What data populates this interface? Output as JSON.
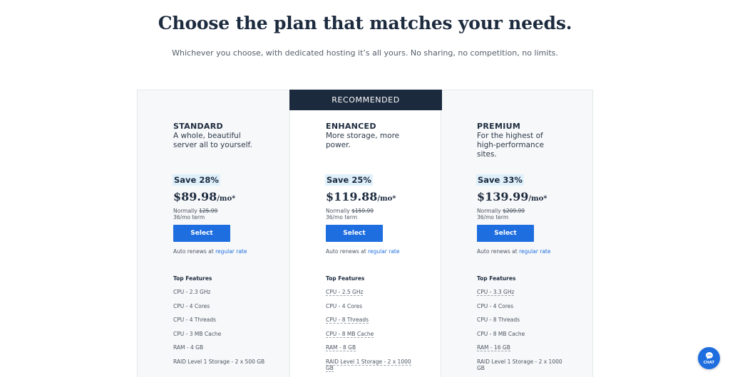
{
  "header": {
    "title": "Choose the plan that matches your needs.",
    "subtitle": "Whichever you choose, with dedicated hosting it’s all yours. No sharing, no competition, no limits."
  },
  "recommended_label": "RECOMMENDED",
  "colors": {
    "accent": "#1e6ee0",
    "dark": "#1c2a3d",
    "save_bg": "#dff0fb"
  },
  "plans": [
    {
      "name": "STANDARD",
      "description": "A whole, beautiful server all to yourself.",
      "save": "Save 28%",
      "price": "$89.98",
      "per": "/mo*",
      "normally_label": "Normally",
      "normally_price": "125.99",
      "term": "36/mo term",
      "select_label": "Select",
      "renews_text": "Auto renews at",
      "renews_link": "regular rate",
      "features_title": "Top Features",
      "features": [
        "CPU - 2.3 GHz",
        "CPU - 4 Cores",
        "CPU - 4 Threads",
        "CPU - 3 MB Cache",
        "RAM - 4 GB",
        "RAID Level 1 Storage - 2 x 500 GB"
      ]
    },
    {
      "name": "ENHANCED",
      "description": "More storage, more power.",
      "save": "Save 25%",
      "price": "$119.88",
      "per": "/mo*",
      "normally_label": "Normally",
      "normally_price": "$159.99",
      "term": "36/mo term",
      "select_label": "Select",
      "renews_text": "Auto renews at",
      "renews_link": "regular rate",
      "features_title": "Top Features",
      "features": [
        "CPU - 2.5 GHz",
        "CPU - 4 Cores",
        "CPU - 8 Threads",
        "CPU - 8 MB Cache",
        "RAM - 8 GB",
        "RAID Level 1 Storage - 2 x 1000 GB"
      ]
    },
    {
      "name": "PREMIUM",
      "description": "For the highest of high-performance sites.",
      "save": "Save 33%",
      "price": "$139.99",
      "per": "/mo*",
      "normally_label": "Normally",
      "normally_price": "$209.99",
      "term": "36/mo term",
      "select_label": "Select",
      "renews_text": "Auto renews at",
      "renews_link": "regular rate",
      "features_title": "Top Features",
      "features": [
        "CPU - 3.3 GHz",
        "CPU - 4 Cores",
        "CPU - 8 Threads",
        "CPU - 8 MB Cache",
        "RAM - 16 GB",
        "RAID Level 1 Storage - 2 x 1000 GB"
      ]
    }
  ],
  "chat": {
    "label": "CHAT",
    "icon": "chat-bubble-icon"
  }
}
